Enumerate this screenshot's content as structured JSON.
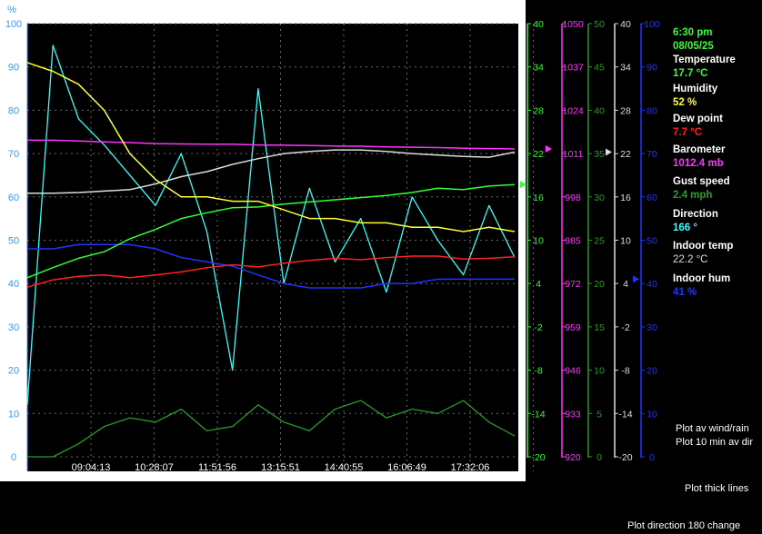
{
  "readout": {
    "time": "6:30 pm",
    "date": "08/05/25",
    "temperature_label": "Temperature",
    "temperature_value": "17.7 °C",
    "humidity_label": "Humidity",
    "humidity_value": "52 %",
    "dewpoint_label": "Dew point",
    "dewpoint_value": "7.7 °C",
    "barometer_label": "Barometer",
    "barometer_value": "1012.4 mb",
    "gust_label": "Gust speed",
    "gust_value": "2.4 mph",
    "direction_label": "Direction",
    "direction_value": "166 °",
    "indoor_temp_label": "Indoor temp",
    "indoor_temp_value": "22.2 °C",
    "indoor_hum_label": "Indoor hum",
    "indoor_hum_value": "41 %"
  },
  "options": {
    "plot_av_wind": "Plot av wind/rain",
    "plot_10min": "Plot 10 min av dir",
    "plot_thick": "Plot thick lines",
    "plot_direction": "Plot direction 180 change"
  },
  "colors": {
    "temperature": "#33ff33",
    "humidity": "#ffff33",
    "dewpoint": "#ff2222",
    "barometer": "#ff33ff",
    "gust": "#2a9a2a",
    "direction": "#33ffff",
    "indoor_temp": "#dddddd",
    "indoor_hum": "#2233ff",
    "time_text": "#33ff33",
    "left_axis": "#3399ff"
  },
  "chart_data": {
    "type": "line",
    "x_ticks": [
      "09:04:13",
      "10:28:07",
      "11:51:56",
      "13:15:51",
      "14:40:55",
      "16:06:49",
      "17:32:06"
    ],
    "grid": true,
    "axes": {
      "percent": {
        "unit_label": "%",
        "ylim": [
          0,
          100
        ],
        "ticks": [
          0,
          10,
          20,
          30,
          40,
          50,
          60,
          70,
          80,
          90,
          100
        ]
      },
      "temperature": {
        "ylim": [
          -20,
          40
        ],
        "ticks": [
          -20,
          -14,
          -8,
          -2,
          4,
          10,
          16,
          22,
          28,
          34,
          40
        ]
      },
      "barometer": {
        "ylim": [
          920,
          1050
        ],
        "ticks": [
          920,
          933,
          946,
          959,
          972,
          985,
          998,
          1011,
          1024,
          1037,
          1050
        ]
      },
      "gust": {
        "ylim": [
          0,
          50
        ],
        "ticks": [
          0,
          5,
          10,
          15,
          20,
          25,
          30,
          35,
          40,
          45,
          50
        ]
      },
      "indoor_temp": {
        "ylim": [
          -20,
          40
        ],
        "ticks": [
          -20,
          -14,
          -8,
          -2,
          4,
          10,
          16,
          22,
          28,
          34,
          40
        ]
      },
      "indoor_hum": {
        "ylim": [
          0,
          100
        ],
        "ticks": [
          0,
          10,
          20,
          30,
          40,
          50,
          60,
          70,
          80,
          90,
          100
        ]
      }
    },
    "series": [
      {
        "name": "Temperature",
        "axis": "temperature",
        "values": [
          4.8,
          6.2,
          7.5,
          8.4,
          10.2,
          11.5,
          13.0,
          13.8,
          14.5,
          14.6,
          15.0,
          15.3,
          15.6,
          15.9,
          16.2,
          16.6,
          17.2,
          17.0,
          17.5,
          17.7
        ]
      },
      {
        "name": "Humidity",
        "axis": "percent",
        "values": [
          91,
          89,
          86,
          80,
          70,
          64,
          60,
          60,
          59,
          59,
          57,
          55,
          55,
          54,
          54,
          53,
          53,
          52,
          53,
          52
        ]
      },
      {
        "name": "Dew point",
        "axis": "temperature",
        "values": [
          3.5,
          4.5,
          5.0,
          5.2,
          4.8,
          5.2,
          5.6,
          6.2,
          6.6,
          6.3,
          6.8,
          7.2,
          7.5,
          7.3,
          7.6,
          7.8,
          7.8,
          7.4,
          7.5,
          7.7
        ]
      },
      {
        "name": "Barometer",
        "axis": "barometer",
        "values": [
          1015.0,
          1015.0,
          1014.8,
          1014.5,
          1014.3,
          1014.0,
          1013.9,
          1013.8,
          1013.8,
          1013.6,
          1013.5,
          1013.4,
          1013.3,
          1013.2,
          1013.0,
          1012.9,
          1012.8,
          1012.6,
          1012.5,
          1012.4
        ]
      },
      {
        "name": "Gust speed",
        "axis": "gust",
        "values": [
          0.0,
          0.0,
          1.5,
          3.5,
          4.5,
          4.0,
          5.5,
          3.0,
          3.5,
          6.0,
          4.0,
          3.0,
          5.5,
          6.5,
          4.5,
          5.5,
          5.0,
          6.5,
          4.0,
          2.4
        ]
      },
      {
        "name": "Direction",
        "axis": "percent",
        "values": [
          12,
          95,
          78,
          72,
          65,
          58,
          70,
          52,
          20,
          85,
          40,
          62,
          45,
          55,
          38,
          60,
          50,
          42,
          58,
          46
        ]
      },
      {
        "name": "Indoor temp",
        "axis": "indoor_temp",
        "values": [
          16.5,
          16.5,
          16.6,
          16.8,
          17.0,
          17.8,
          18.8,
          19.5,
          20.5,
          21.3,
          22.0,
          22.3,
          22.5,
          22.5,
          22.3,
          22.0,
          21.8,
          21.6,
          21.5,
          22.2
        ]
      },
      {
        "name": "Indoor hum",
        "axis": "indoor_hum",
        "values": [
          48,
          48,
          49,
          49,
          49,
          48,
          46,
          45,
          44,
          42,
          40,
          39,
          39,
          39,
          40,
          40,
          41,
          41,
          41,
          41
        ]
      }
    ]
  }
}
